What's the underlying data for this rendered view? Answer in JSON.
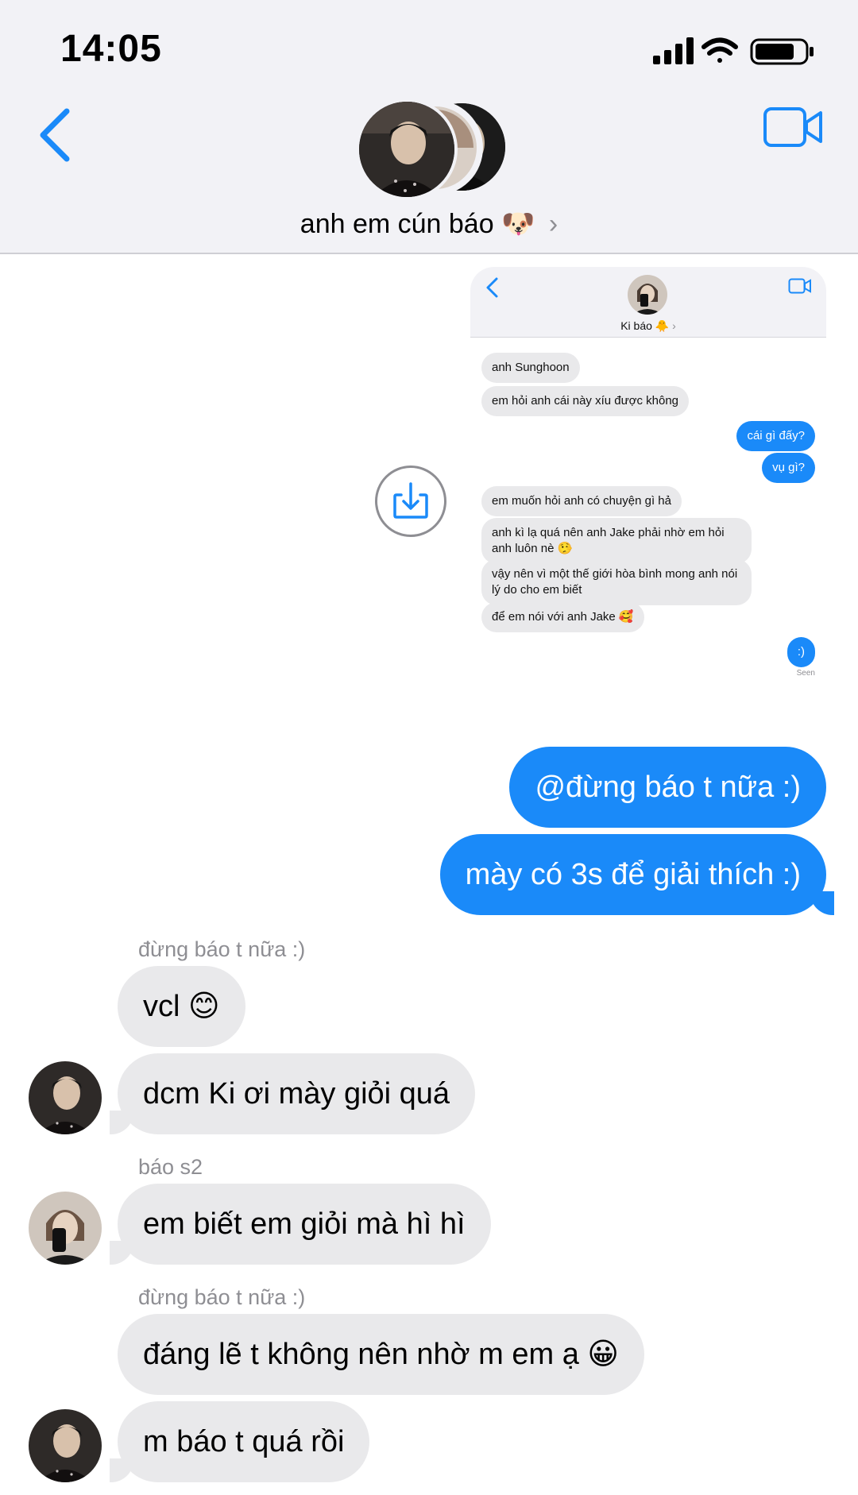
{
  "status_bar": {
    "time": "14:05"
  },
  "header": {
    "group_name": "anh em cún báo",
    "group_emoji": "🐶",
    "chevron": "›"
  },
  "icons": {
    "back": "chevron-left-icon",
    "video": "video-camera-icon",
    "save": "download-icon",
    "signal": "cellular-signal-icon",
    "wifi": "wifi-icon",
    "battery": "battery-icon"
  },
  "colors": {
    "accent": "#1a8af9",
    "incoming": "#e9e9eb",
    "header_bg": "#f2f2f6"
  },
  "screenshot": {
    "contact_name": "Ki báo",
    "contact_emoji": "🐥",
    "messages": [
      {
        "dir": "in",
        "text": "anh Sunghoon"
      },
      {
        "dir": "in",
        "text": "em hỏi anh cái này xíu được không"
      },
      {
        "dir": "out",
        "text": "cái gì đấy?"
      },
      {
        "dir": "out",
        "text": "vụ gì?"
      },
      {
        "dir": "in",
        "text": "em muốn hỏi anh có chuyện gì hả"
      },
      {
        "dir": "in",
        "text": "anh kì lạ quá nên anh Jake phải nhờ em hỏi anh luôn nè 🤥"
      },
      {
        "dir": "in",
        "text": "vậy nên vì một thế giới hòa bình mong anh nói lý do cho em biết"
      },
      {
        "dir": "in",
        "text": "để em nói với anh Jake 🥰"
      },
      {
        "dir": "out",
        "text": ":)"
      }
    ],
    "seen_label": "Seen"
  },
  "messages": [
    {
      "dir": "out",
      "text": "@đừng báo t nữa :)"
    },
    {
      "dir": "out",
      "text": "mày có 3s để giải thích :)"
    },
    {
      "sender": "đừng báo t nữa :)"
    },
    {
      "dir": "in",
      "text": "vcl 😊"
    },
    {
      "dir": "in",
      "text": "dcm Ki ơi mày giỏi quá"
    },
    {
      "sender": "báo s2"
    },
    {
      "dir": "in",
      "text": "em biết em giỏi mà hì hì"
    },
    {
      "sender": "đừng báo t nữa :)"
    },
    {
      "dir": "in",
      "text": "đáng lẽ t không nên nhờ m em ạ 😀"
    },
    {
      "dir": "in",
      "text": "m báo t quá rồi"
    }
  ]
}
